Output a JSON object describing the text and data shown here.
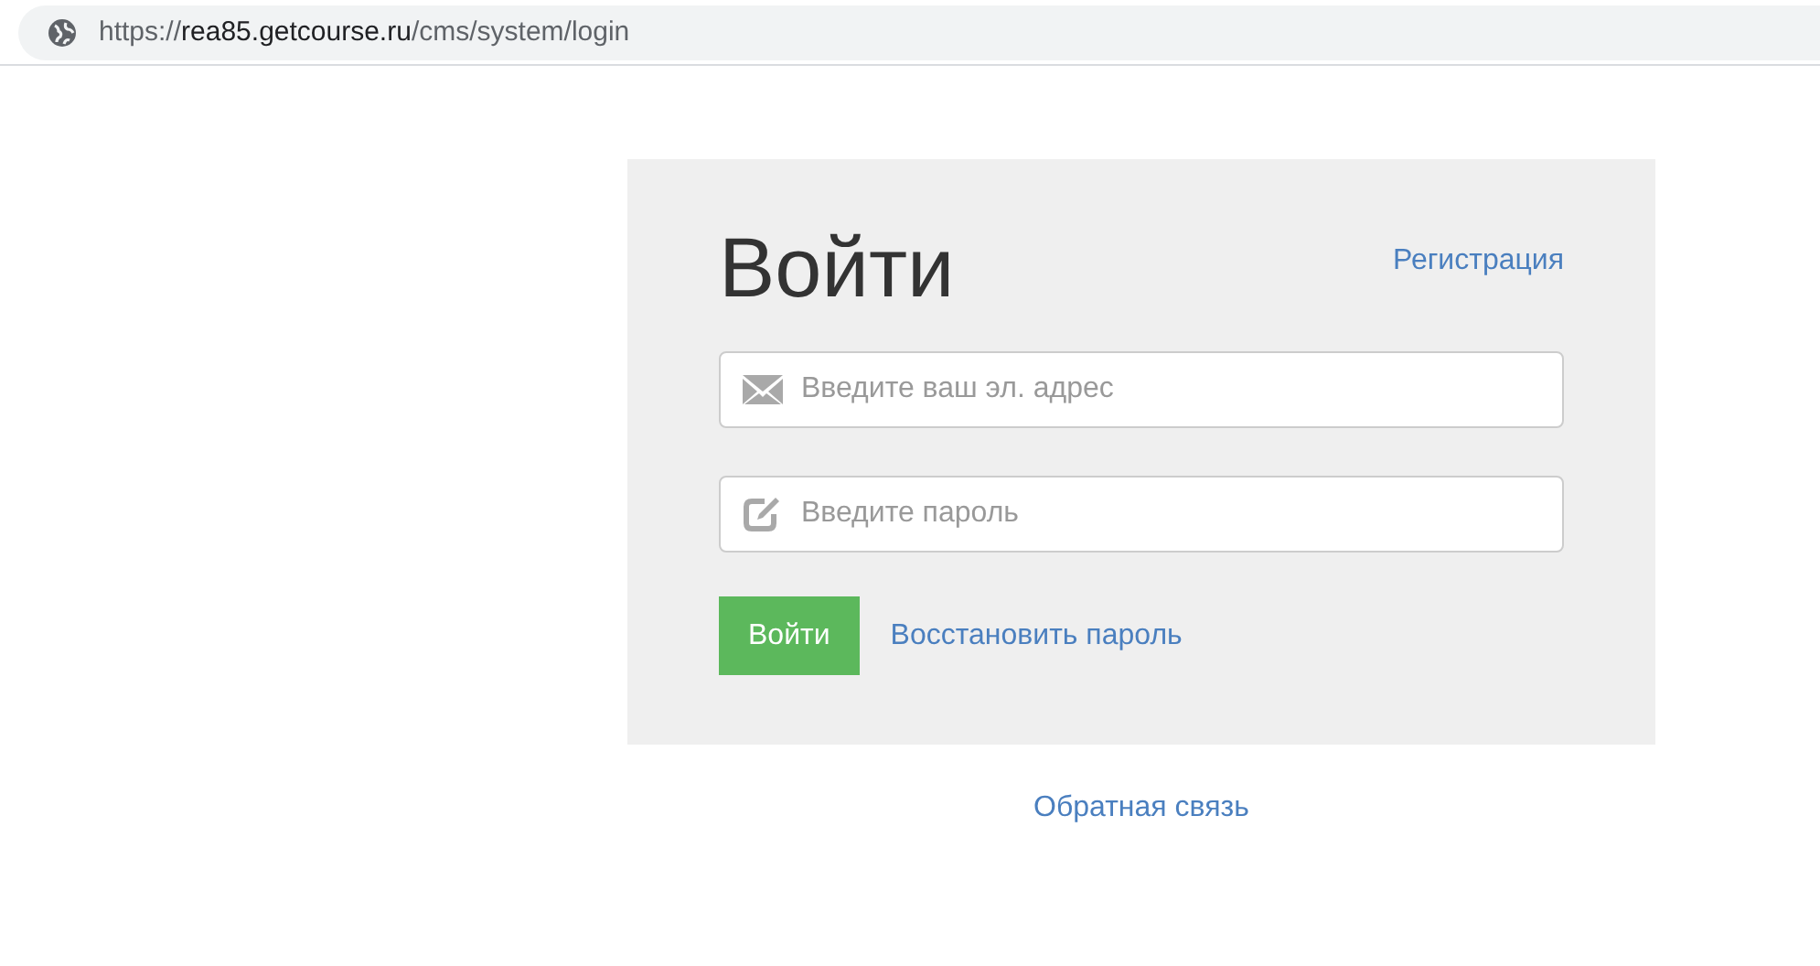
{
  "address_bar": {
    "url_parts": [
      {
        "text": "https://",
        "kind": "dim"
      },
      {
        "text": "rea85.getcourse.ru",
        "kind": "host"
      },
      {
        "text": "/cms/system/login",
        "kind": "dim"
      }
    ]
  },
  "login": {
    "title": "Войти",
    "register_link": "Регистрация",
    "fields": [
      {
        "kind": "email",
        "placeholder": "Введите ваш эл. адрес"
      },
      {
        "kind": "password",
        "placeholder": "Введите пароль"
      }
    ],
    "submit": "Войти",
    "restore_link": "Восстановить пароль"
  },
  "feedback_link": "Обратная связь"
}
